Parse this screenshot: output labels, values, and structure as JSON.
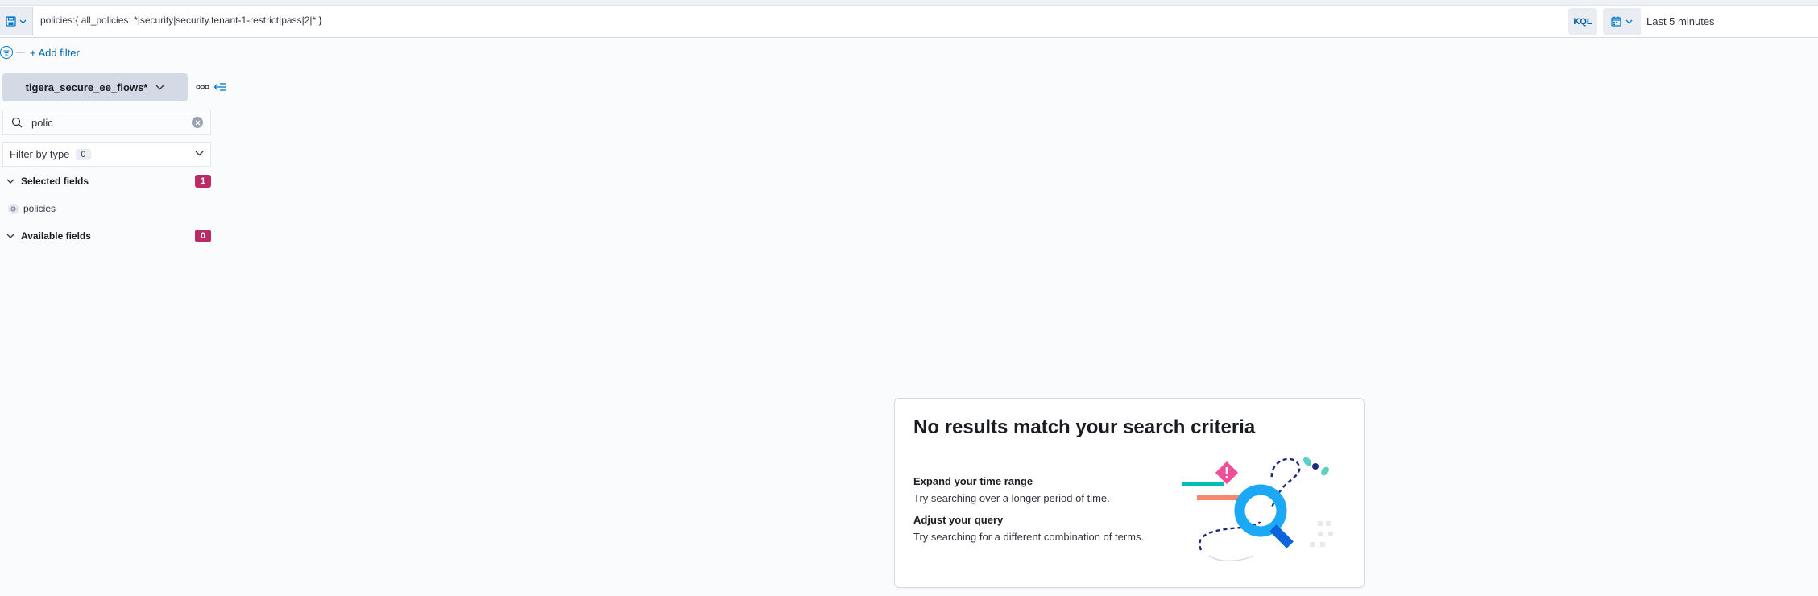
{
  "query_bar": {
    "query": "policies:{ all_policies: *|security|security.tenant-1-restrict|pass|2|* }",
    "language": "KQL",
    "time_range": "Last 5 minutes"
  },
  "filters": {
    "add_filter_label": "+ Add filter"
  },
  "sidebar": {
    "index_pattern": "tigera_secure_ee_flows*",
    "search_value": "polic",
    "filter_by_type_label": "Filter by type",
    "filter_by_type_count": "0",
    "selected_fields": {
      "title": "Selected fields",
      "count": "1",
      "items": [
        {
          "name": "policies",
          "type_icon": "object-type-icon"
        }
      ]
    },
    "available_fields": {
      "title": "Available fields",
      "count": "0"
    }
  },
  "empty_state": {
    "title": "No results match your search criteria",
    "tips": [
      {
        "heading": "Expand your time range",
        "text": "Try searching over a longer period of time."
      },
      {
        "heading": "Adjust your query",
        "text": "Try searching for a different combination of terms."
      }
    ]
  },
  "colors": {
    "accent": "#0077cc",
    "badge": "#bd2b67",
    "illustration_primary": "#1ba9f5",
    "illustration_pink": "#f04e98",
    "illustration_teal": "#00bfb3",
    "illustration_salmon": "#f9876b"
  }
}
